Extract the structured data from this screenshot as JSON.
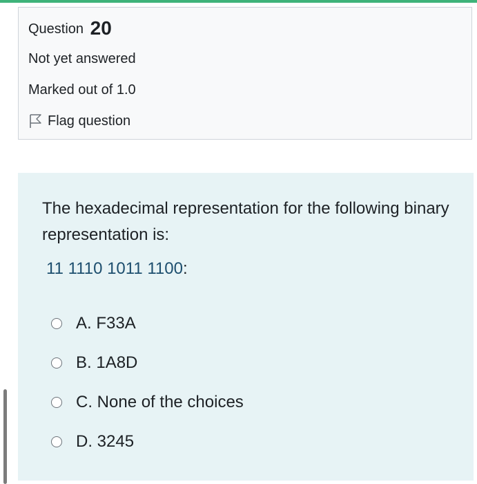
{
  "question_info": {
    "label": "Question",
    "number": "20",
    "state": "Not yet answered",
    "grade": "Marked out of 1.0",
    "flag_label": "Flag question"
  },
  "question": {
    "text": "The hexadecimal representation for the following binary representation is:",
    "binary_value": "11 1110 1011 1100",
    "binary_suffix": ":",
    "options": [
      {
        "label": "A. F33A"
      },
      {
        "label": "B. 1A8D"
      },
      {
        "label": "C. None of the choices"
      },
      {
        "label": "D. 3245"
      }
    ]
  },
  "colors": {
    "accent_bar": "#3fb37a",
    "info_background": "#f8f9fa",
    "content_background": "#e7f3f5",
    "binary_text": "#1d4e6e"
  }
}
